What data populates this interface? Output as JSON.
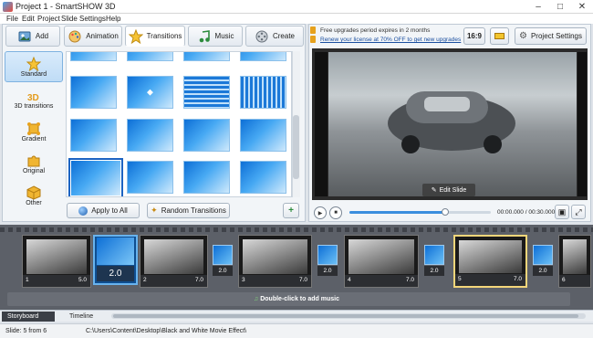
{
  "window": {
    "title": "Project 1 - SmartSHOW 3D"
  },
  "menu": [
    "File",
    "Edit",
    "Project",
    "Slide",
    "Settings",
    "Help"
  ],
  "tabs": [
    {
      "label": "Add"
    },
    {
      "label": "Animation"
    },
    {
      "label": "Transitions"
    },
    {
      "label": "Music"
    },
    {
      "label": "Create"
    }
  ],
  "categories": [
    {
      "label": "Standard"
    },
    {
      "label": "3D transitions"
    },
    {
      "label": "Gradient"
    },
    {
      "label": "Original"
    },
    {
      "label": "Other"
    }
  ],
  "transition_buttons": {
    "apply_all": "Apply to All",
    "random": "Random Transitions"
  },
  "notice": {
    "line1": "Free upgrades period expires in 2 months",
    "line2": "Renew your license at 70% OFF to get new upgrades"
  },
  "toolbar": {
    "ratio": "16:9",
    "project_settings": "Project Settings"
  },
  "preview": {
    "edit_slide": "Edit Slide",
    "time": "00:00.000 / 00:30.000"
  },
  "slides": [
    {
      "num": "1",
      "dur": "5.0"
    },
    {
      "num": "2",
      "dur": "7.0"
    },
    {
      "num": "3",
      "dur": "7.0"
    },
    {
      "num": "4",
      "dur": "7.0"
    },
    {
      "num": "5",
      "dur": "7.0"
    },
    {
      "num": "6",
      "dur": ""
    }
  ],
  "transitions": [
    {
      "dur": "2.0"
    },
    {
      "dur": "2.0"
    },
    {
      "dur": "2.0"
    },
    {
      "dur": "2.0"
    },
    {
      "dur": "2.0"
    }
  ],
  "music_hint": "Double-click to add music",
  "bottom_tabs": [
    "Storyboard",
    "Timeline"
  ],
  "status": {
    "slide": "Slide: 5 from 6",
    "path": "C:\\Users\\Content\\Desktop\\Black and White Movie Effect\\"
  }
}
